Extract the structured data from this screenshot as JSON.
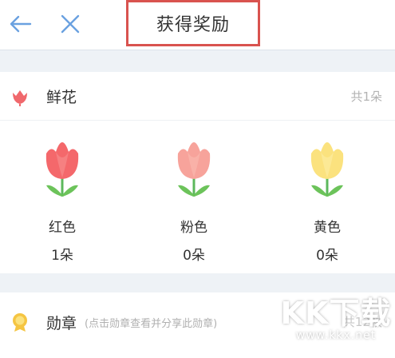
{
  "header": {
    "title": "获得奖励",
    "back_icon": "arrow-left-icon",
    "close_icon": "close-icon",
    "icon_color": "#6aa1e0",
    "highlight_color": "#d9534f"
  },
  "flowers": {
    "title": "鲜花",
    "total": "共1朵",
    "icon": "tulip-icon",
    "items": [
      {
        "name": "红色",
        "count": "1朵",
        "color": "#f4686b"
      },
      {
        "name": "粉色",
        "count": "0朵",
        "color": "#f7a39b"
      },
      {
        "name": "黄色",
        "count": "0朵",
        "color": "#fbe27e"
      }
    ]
  },
  "medals": {
    "title": "勋章",
    "hint": "(点击勋章查看并分享此勋章)",
    "total": "共12枚",
    "icon": "medal-icon"
  },
  "watermark": {
    "logo": "KK下载",
    "url": "www.kkx.net"
  }
}
